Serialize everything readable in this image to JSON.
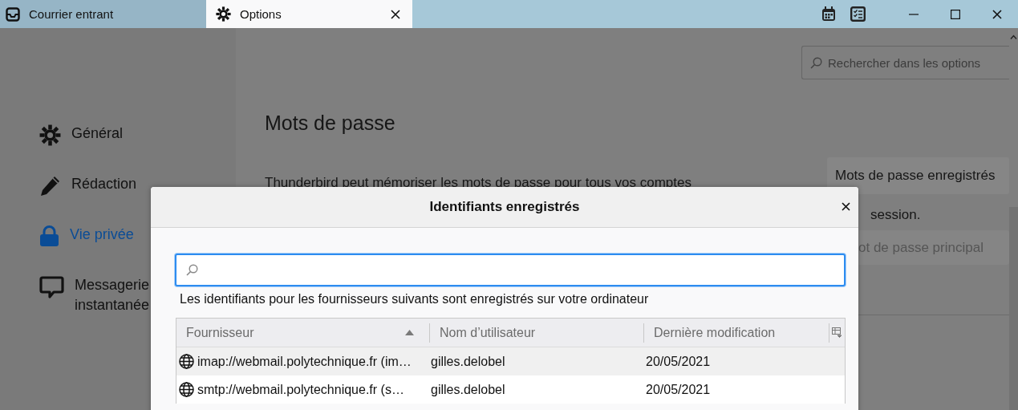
{
  "tabs": [
    {
      "label": "Courrier entrant",
      "selected": false
    },
    {
      "label": "Options",
      "selected": true,
      "closable": true
    }
  ],
  "options_search": {
    "placeholder": "Rechercher dans les options"
  },
  "sidebar": {
    "items": [
      {
        "label": "Général",
        "selected": false
      },
      {
        "label": "Rédaction",
        "selected": false
      },
      {
        "label": "Vie privée",
        "selected": true
      },
      {
        "label": "Messagerie instantanée",
        "selected": false
      }
    ]
  },
  "main": {
    "heading": "Mots de passe",
    "description": "Thunderbird peut mémoriser les mots de passe pour tous vos comptes",
    "saved_passwords_button": {
      "label": "Mots de passe enregistrés",
      "disabled": false
    },
    "side_text": "session.",
    "primary_password_button": {
      "label": "ot de passe principal",
      "disabled": true
    }
  },
  "dialog": {
    "title": "Identifiants enregistrés",
    "note": "Les identifiants pour les fournisseurs suivants sont enregistrés sur votre ordinateur",
    "columns": [
      {
        "label": "Fournisseur",
        "sorted": true
      },
      {
        "label": "Nom d’utilisateur",
        "sorted": false
      },
      {
        "label": "Dernière modification",
        "sorted": false
      }
    ],
    "rows": [
      {
        "cells": [
          "imap://webmail.polytechnique.fr (im…",
          "gilles.delobel",
          "20/05/2021"
        ]
      },
      {
        "cells": [
          "smtp://webmail.polytechnique.fr (s…",
          "gilles.delobel",
          "20/05/2021"
        ]
      }
    ]
  }
}
